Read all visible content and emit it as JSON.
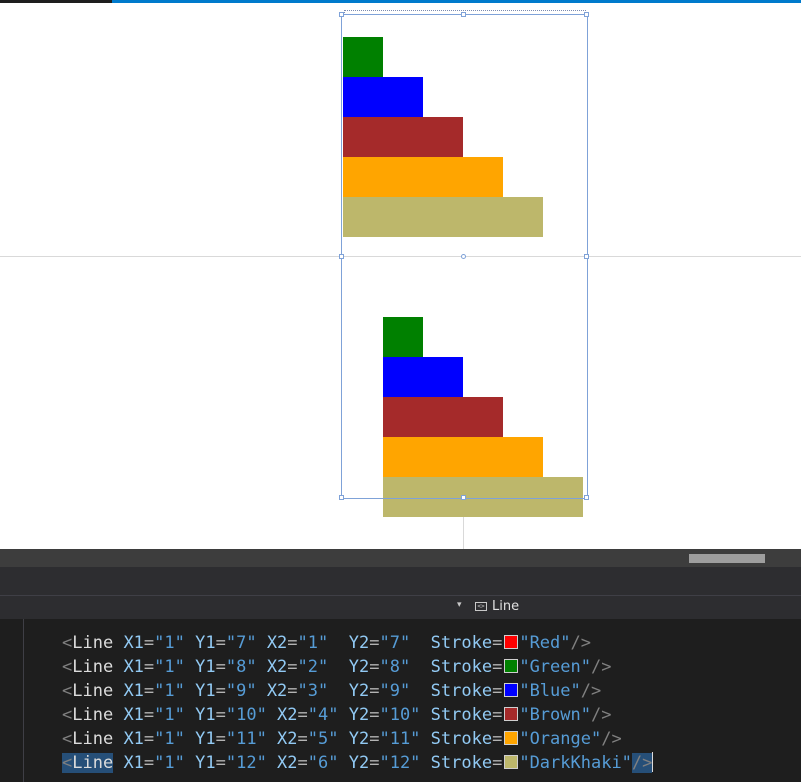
{
  "designer": {
    "upper_stack": [
      {
        "color": "#008000"
      },
      {
        "color": "#0000ff"
      },
      {
        "color": "#a52a2a"
      },
      {
        "color": "#ffa500"
      },
      {
        "color": "#bdb76b"
      }
    ],
    "lower_stack": [
      {
        "color": "#008000"
      },
      {
        "color": "#0000ff"
      },
      {
        "color": "#a52a2a"
      },
      {
        "color": "#ffa500"
      },
      {
        "color": "#bdb76b"
      }
    ]
  },
  "navigation_bar": {
    "element_icon": "xaml-element-icon",
    "element_label": "Line"
  },
  "code_lines": [
    {
      "tag": "Line",
      "x1": "\"1\"",
      "y1": "\"7\"",
      "x2": "\"1\"",
      "y2": "\"7\"",
      "stroke": "\"Red\"",
      "swatch": "#ff0000"
    },
    {
      "tag": "Line",
      "x1": "\"1\"",
      "y1": "\"8\"",
      "x2": "\"2\"",
      "y2": "\"8\"",
      "stroke": "\"Green\"",
      "swatch": "#008000"
    },
    {
      "tag": "Line",
      "x1": "\"1\"",
      "y1": "\"9\"",
      "x2": "\"3\"",
      "y2": "\"9\"",
      "stroke": "\"Blue\"",
      "swatch": "#0000ff"
    },
    {
      "tag": "Line",
      "x1": "\"1\"",
      "y1": "\"10\"",
      "x2": "\"4\"",
      "y2": "\"10\"",
      "stroke": "\"Brown\"",
      "swatch": "#a52a2a"
    },
    {
      "tag": "Line",
      "x1": "\"1\"",
      "y1": "\"11\"",
      "x2": "\"5\"",
      "y2": "\"11\"",
      "stroke": "\"Orange\"",
      "swatch": "#ffa500"
    },
    {
      "tag": "Line",
      "x1": "\"1\"",
      "y1": "\"12\"",
      "x2": "\"6\"",
      "y2": "\"12\"",
      "stroke": "\"DarkKhaki\"",
      "swatch": "#bdb76b"
    }
  ]
}
